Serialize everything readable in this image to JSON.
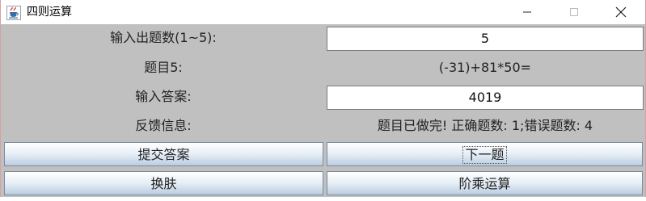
{
  "window": {
    "title": "四则运算"
  },
  "form": {
    "count_label": "输入出题数(1~5):",
    "count_value": "5",
    "question_label": "题目5:",
    "question_text": "(-31)+81*50=",
    "answer_label": "输入答案:",
    "answer_value": "4019",
    "feedback_label": "反馈信息:",
    "feedback_text": "题目已做完! 正确题数: 1;错误题数: 4"
  },
  "buttons": {
    "submit": "提交答案",
    "next": "下一题",
    "skin": "换肤",
    "factorial": "阶乘运算"
  }
}
